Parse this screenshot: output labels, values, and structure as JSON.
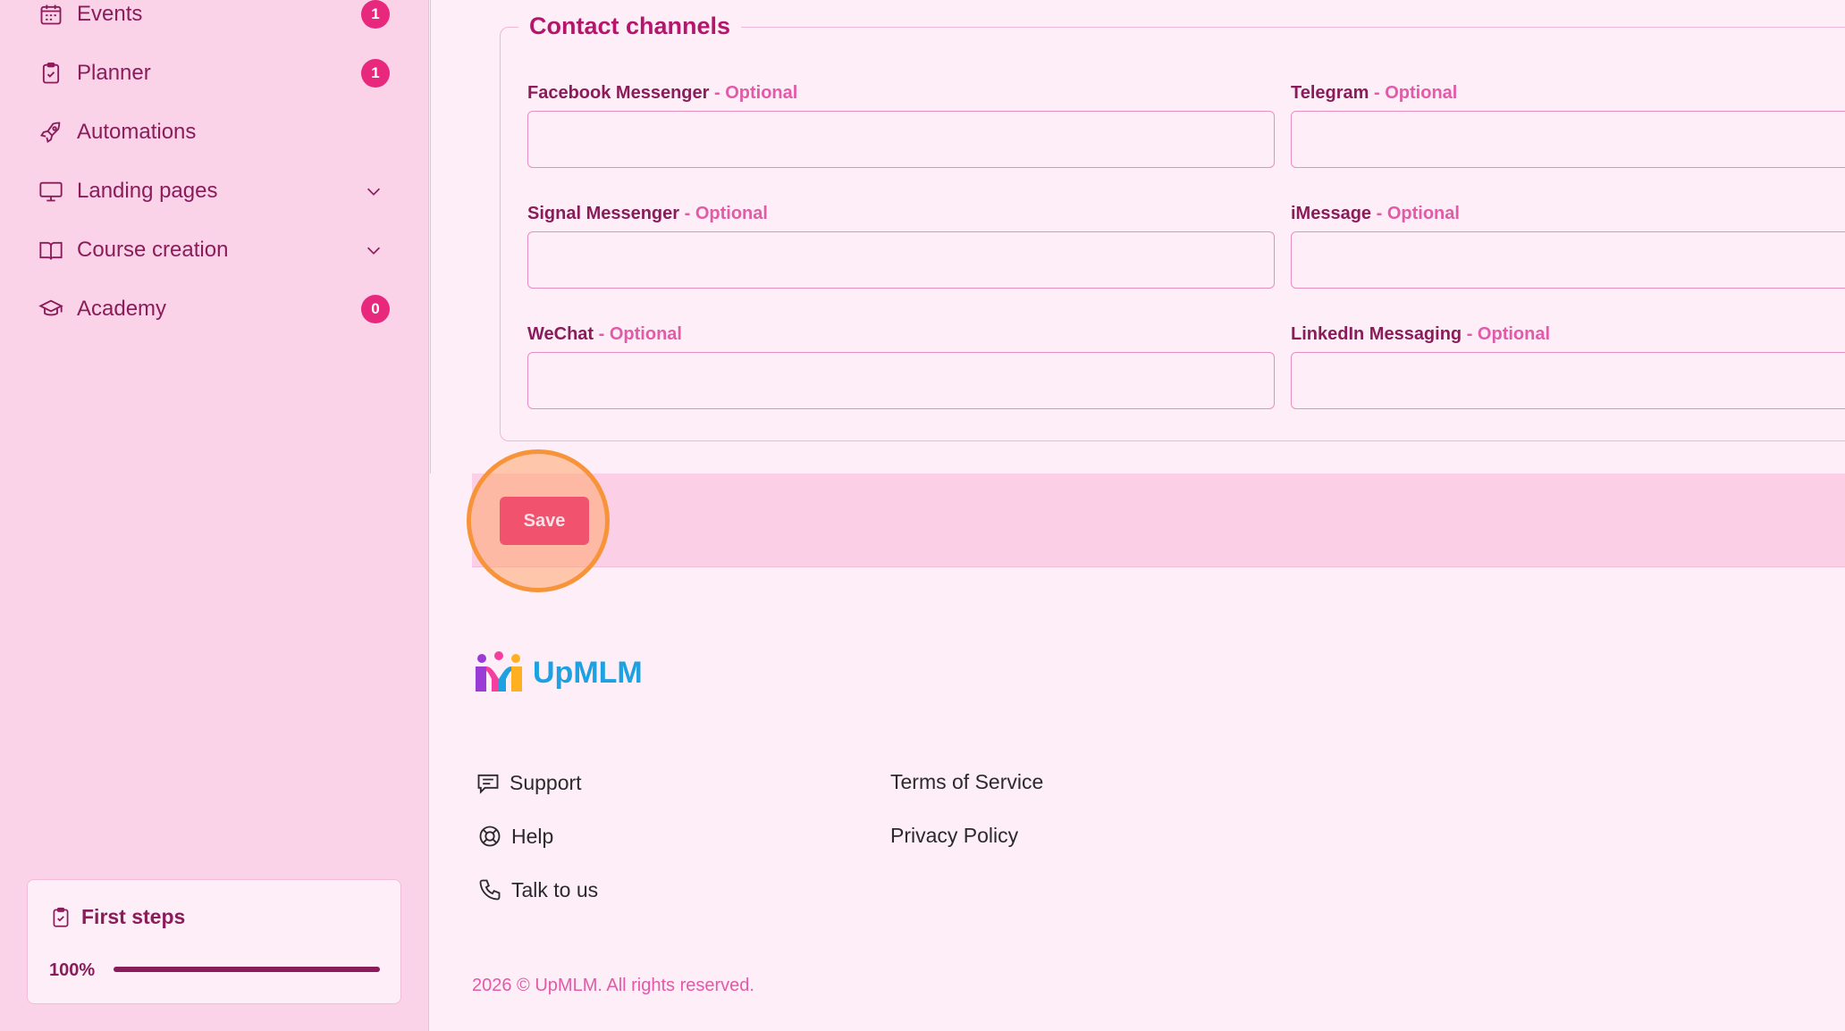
{
  "sidebar": {
    "items": [
      {
        "label": "Events",
        "icon": "calendar-icon",
        "badge": "1"
      },
      {
        "label": "Planner",
        "icon": "clipboard-check-icon",
        "badge": "1"
      },
      {
        "label": "Automations",
        "icon": "rocket-icon"
      },
      {
        "label": "Landing pages",
        "icon": "monitor-icon"
      },
      {
        "label": "Course creation",
        "icon": "book-open-icon"
      },
      {
        "label": "Academy",
        "icon": "graduation-cap-icon",
        "badge": "0"
      }
    ],
    "first_steps": {
      "title": "First steps",
      "progress_text": "100%",
      "progress": 1.0
    }
  },
  "form": {
    "legend": "Contact channels",
    "optional_suffix": "- Optional",
    "fields": [
      {
        "label": "Facebook Messenger",
        "value": ""
      },
      {
        "label": "Telegram",
        "value": ""
      },
      {
        "label": "Signal Messenger",
        "value": ""
      },
      {
        "label": "iMessage",
        "value": ""
      },
      {
        "label": "WeChat",
        "value": ""
      },
      {
        "label": "LinkedIn Messaging",
        "value": ""
      }
    ],
    "save_label": "Save"
  },
  "footer": {
    "brand": "UpMLM",
    "links_left": [
      {
        "label": "Support",
        "icon": "chat-icon"
      },
      {
        "label": "Help",
        "icon": "lifebuoy-icon"
      },
      {
        "label": "Talk to us",
        "icon": "phone-icon"
      }
    ],
    "links_right": [
      {
        "label": "Terms of Service"
      },
      {
        "label": "Privacy Policy"
      }
    ],
    "copyright": "2026 © UpMLM. All rights reserved."
  },
  "colors": {
    "sidebar_bg": "#fbd3e9",
    "accent": "#8a1c5a",
    "badge": "#e8287c",
    "save_button": "#f1536f",
    "highlight_ring": "#f7943a",
    "brand_blue": "#1da1e0"
  }
}
